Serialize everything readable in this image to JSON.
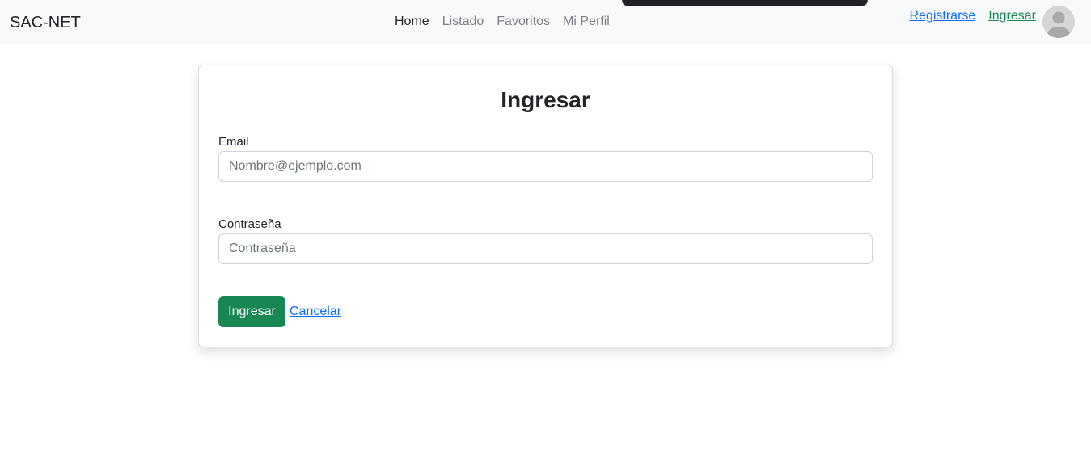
{
  "navbar": {
    "brand": "SAC-NET",
    "links": [
      "Home",
      "Listado",
      "Favoritos",
      "Mi Perfil"
    ],
    "register_label": "Registrarse",
    "login_label": "Ingresar"
  },
  "login_card": {
    "title": "Ingresar",
    "email_label": "Email",
    "email_placeholder": "Nombre@ejemplo.com",
    "password_label": "Contraseña",
    "password_placeholder": "Contraseña",
    "submit_label": "Ingresar",
    "cancel_label": "Cancelar"
  },
  "colors": {
    "primary_link": "#0d6efd",
    "success": "#198754",
    "navbar_bg": "#f8f9fa"
  }
}
